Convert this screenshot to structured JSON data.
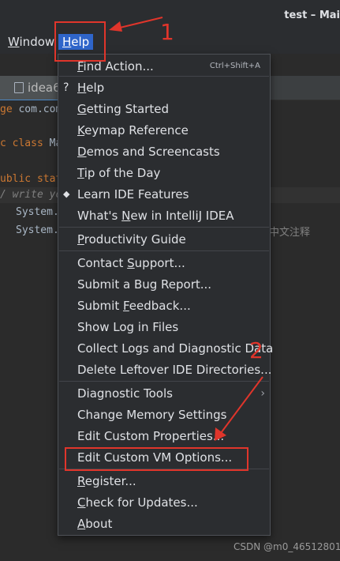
{
  "window": {
    "title": "test – Mai"
  },
  "menubar": {
    "window": {
      "mnemonic": "W",
      "rest": "indow"
    },
    "help": {
      "mnemonic": "H",
      "rest": "elp"
    }
  },
  "tab": {
    "label": "idea6"
  },
  "editor": {
    "line1": {
      "kw": "ge",
      "text": " com.com"
    },
    "line2": {
      "kw": "c class",
      "text": " Ma"
    },
    "line3": {
      "kw": "ublic stat"
    },
    "line4": {
      "comment": "/ write yo"
    },
    "line5": {
      "text": "System."
    },
    "line6": {
      "text": "System."
    },
    "cn_comment": "中文注释"
  },
  "menu": {
    "items": [
      {
        "pre": "",
        "mn": "F",
        "post": "ind Action...",
        "shortcut": "Ctrl+Shift+A"
      },
      {
        "pre": "",
        "mn": "H",
        "post": "elp",
        "icon": "?"
      },
      {
        "pre": "",
        "mn": "G",
        "post": "etting Started"
      },
      {
        "pre": "",
        "mn": "K",
        "post": "eymap Reference"
      },
      {
        "pre": "",
        "mn": "D",
        "post": "emos and Screencasts"
      },
      {
        "pre": "",
        "mn": "T",
        "post": "ip of the Day"
      },
      {
        "pre": "Learn IDE Features",
        "mn": "",
        "post": "",
        "icon": "◆"
      },
      {
        "pre": "What's ",
        "mn": "N",
        "post": "ew in IntelliJ IDEA"
      },
      {
        "pre": "",
        "mn": "P",
        "post": "roductivity Guide"
      },
      {
        "pre": "Contact ",
        "mn": "S",
        "post": "upport..."
      },
      {
        "pre": "Submit a Bug Report...",
        "mn": "",
        "post": ""
      },
      {
        "pre": "Submit ",
        "mn": "F",
        "post": "eedback..."
      },
      {
        "pre": "Show Log in Files",
        "mn": "",
        "post": ""
      },
      {
        "pre": "Collect Logs and Diagnostic Data",
        "mn": "",
        "post": ""
      },
      {
        "pre": "Delete Leftover IDE Directories...",
        "mn": "",
        "post": ""
      },
      {
        "pre": "Diagnostic Tools",
        "mn": "",
        "post": ""
      },
      {
        "pre": "Change Memory Settings",
        "mn": "",
        "post": ""
      },
      {
        "pre": "Edit Custom Properties...",
        "mn": "",
        "post": ""
      },
      {
        "pre": "Edit Custom VM Options...",
        "mn": "",
        "post": ""
      },
      {
        "pre": "",
        "mn": "R",
        "post": "egister..."
      },
      {
        "pre": "",
        "mn": "C",
        "post": "heck for Updates..."
      },
      {
        "pre": "",
        "mn": "A",
        "post": "bout"
      }
    ]
  },
  "annotations": {
    "num1": "1",
    "num2": "2"
  },
  "watermark": "CSDN @m0_46512801",
  "colors": {
    "accent": "#2f65ca",
    "annotation": "#e0352b",
    "menu_bg": "#2b2d30"
  },
  "icons": {
    "submenu_arrow": "chevron-right-icon",
    "learn": "graduation-cap-icon",
    "help": "question-mark-icon",
    "file": "java-file-icon"
  }
}
